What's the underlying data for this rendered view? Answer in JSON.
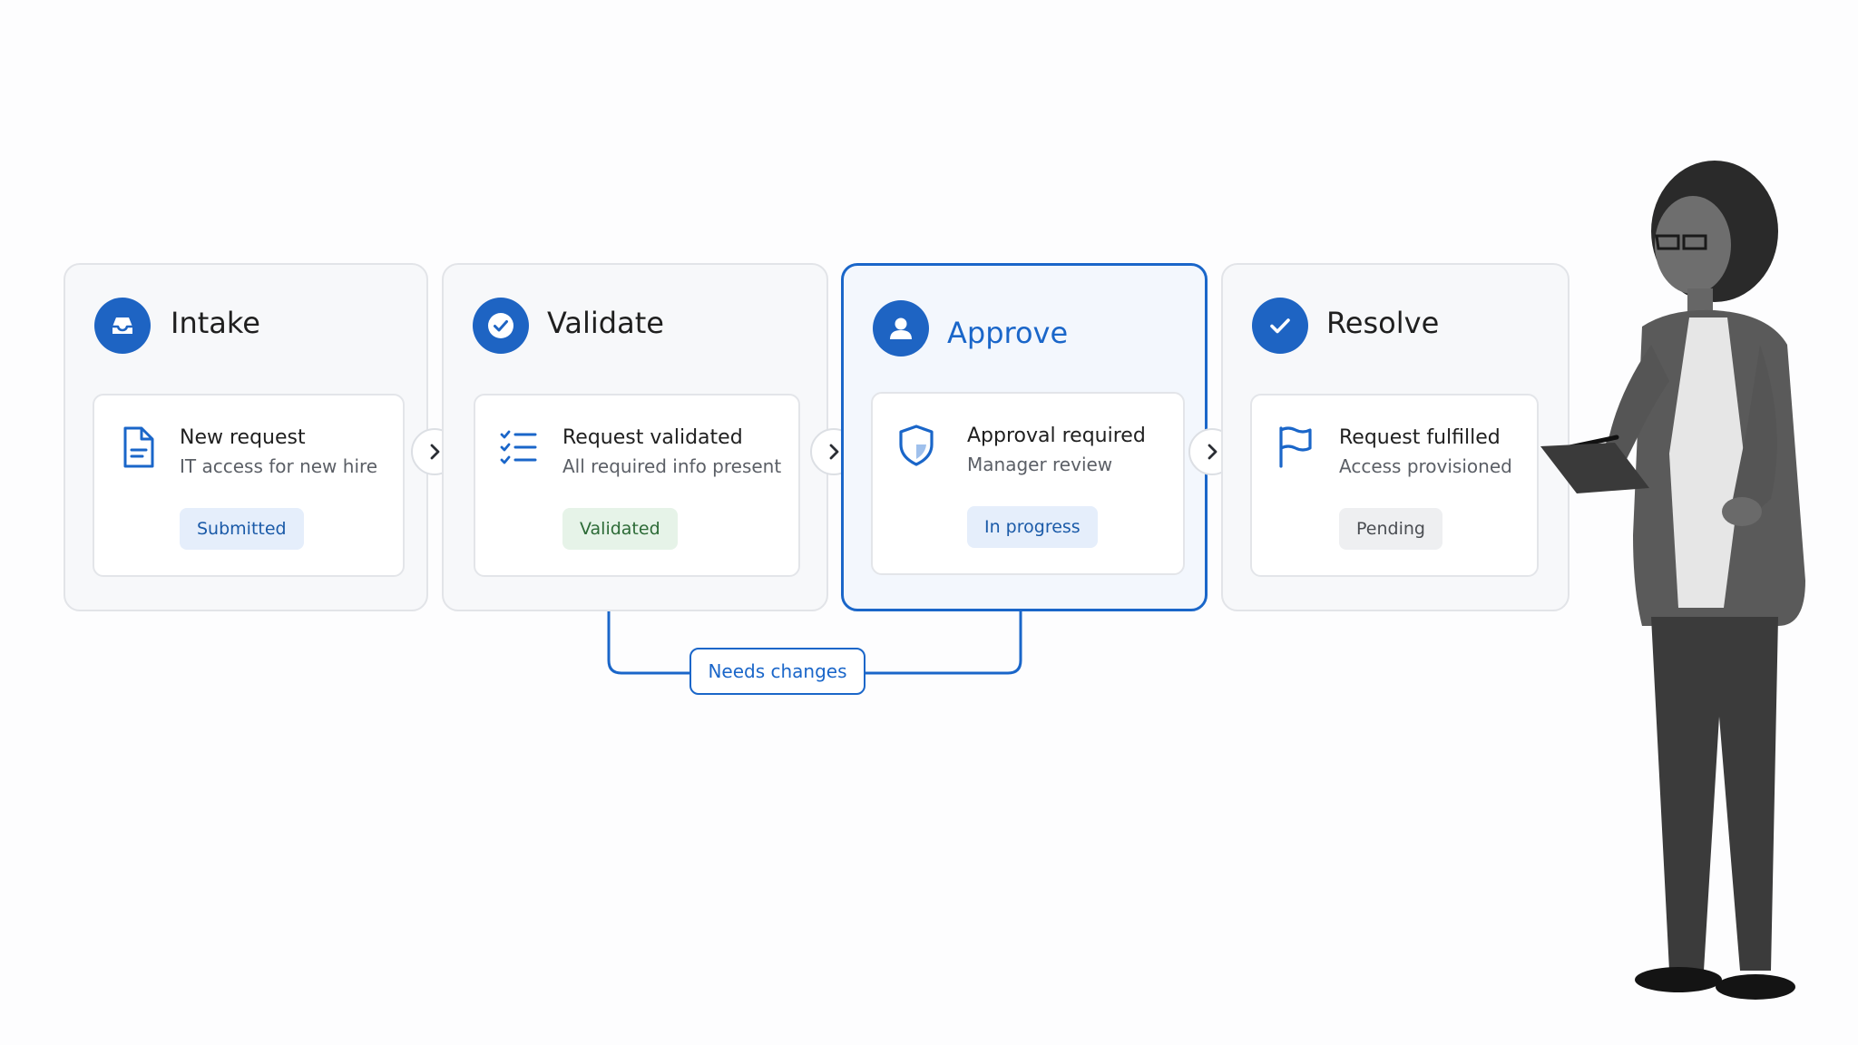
{
  "stages": [
    {
      "title": "Intake",
      "card_title": "New request",
      "card_sub": "IT access for new hire",
      "badge": "Submitted",
      "stage_icon": "inbox-icon",
      "card_icon": "document-icon"
    },
    {
      "title": "Validate",
      "card_title": "Request validated",
      "card_sub": "All required info present",
      "badge": "Validated",
      "stage_icon": "check-circle-icon",
      "card_icon": "checklist-icon"
    },
    {
      "title": "Approve",
      "card_title": "Approval required",
      "card_sub": "Manager review",
      "badge": "In progress",
      "stage_icon": "user-icon",
      "card_icon": "shield-icon"
    },
    {
      "title": "Resolve",
      "card_title": "Request fulfilled",
      "card_sub": "Access provisioned",
      "badge": "Pending",
      "stage_icon": "checkmark-icon",
      "card_icon": "flag-icon"
    }
  ],
  "loop": {
    "label": "Needs changes"
  },
  "colors": {
    "accent": "#1a66c9",
    "icon_fill": "#1e64c3",
    "green_badge": "#e6f3e8",
    "blue_badge": "#e5eefb",
    "grey_badge": "#eeeff1"
  }
}
